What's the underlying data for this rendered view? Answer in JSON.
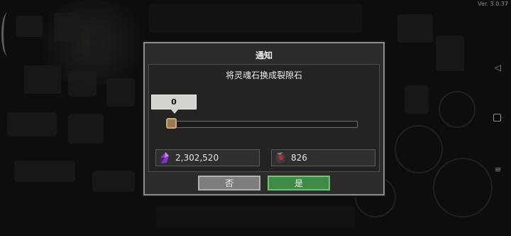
{
  "version": "Ver. 3.0.37",
  "dialog": {
    "title": "通知",
    "message": "将灵魂石换成裂隙石",
    "slider": {
      "value": "0",
      "level": 0
    },
    "resources": {
      "soul_stone": {
        "icon": "soul-stone-icon",
        "amount": "2,302,520"
      },
      "rift_stone": {
        "icon": "rift-stone-icon",
        "amount": "826"
      }
    },
    "buttons": {
      "no": "否",
      "yes": "是"
    }
  },
  "colors": {
    "dialog_bg": "#2c2c2b",
    "knob": "#9a7a55",
    "yes_button": "#3f8a44",
    "no_button": "#7d7d7b"
  }
}
